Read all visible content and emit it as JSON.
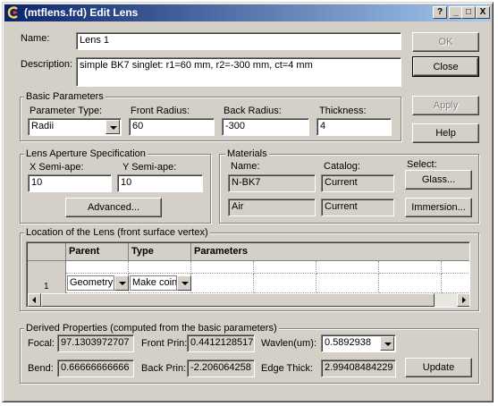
{
  "window": {
    "title": "(mtflens.frd) Edit Lens",
    "help_label": "?",
    "minimize_label": "_",
    "maximize_label": "□",
    "close_label": "X"
  },
  "name": {
    "label": "Name:",
    "value": "Lens 1"
  },
  "description": {
    "label": "Description:",
    "value": "simple BK7 singlet: r1=60 mm, r2=-300 mm, ct=4 mm"
  },
  "buttons": {
    "ok": "OK",
    "close": "Close",
    "apply": "Apply",
    "help": "Help",
    "advanced": "Advanced...",
    "glass": "Glass...",
    "immersion": "Immersion...",
    "update": "Update"
  },
  "basic_parameters": {
    "title": "Basic Parameters",
    "parameter_type_label": "Parameter Type:",
    "parameter_type_value": "Radii",
    "front_radius_label": "Front Radius:",
    "front_radius_value": "60",
    "back_radius_label": "Back Radius:",
    "back_radius_value": "-300",
    "thickness_label": "Thickness:",
    "thickness_value": "4"
  },
  "aperture": {
    "title": "Lens Aperture Specification",
    "x_label": "X Semi-ape:",
    "x_value": "10",
    "y_label": "Y Semi-ape:",
    "y_value": "10"
  },
  "materials": {
    "title": "Materials",
    "name_header": "Name:",
    "catalog_header": "Catalog:",
    "select_header": "Select:",
    "rows": [
      {
        "name": "N-BK7",
        "catalog": "Current"
      },
      {
        "name": "Air",
        "catalog": "Current"
      }
    ]
  },
  "location": {
    "title": "Location of the Lens (front surface vertex)",
    "columns": [
      "Parent",
      "Type",
      "Parameters"
    ],
    "row_number": "1",
    "parent_value": "Geometry",
    "type_value": "Make coin"
  },
  "derived": {
    "title": "Derived Properties (computed from the basic parameters)",
    "focal_label": "Focal:",
    "focal_value": "97.1303972707",
    "front_prin_label": "Front Prin:",
    "front_prin_value": "0.4412128517",
    "wavlen_label": "Wavlen(um):",
    "wavlen_value": "0.5892938",
    "bend_label": "Bend:",
    "bend_value": "0.66666666666",
    "back_prin_label": "Back Prin:",
    "back_prin_value": "-2.206064258",
    "edge_thick_label": "Edge Thick:",
    "edge_thick_value": "2.99408484229"
  }
}
